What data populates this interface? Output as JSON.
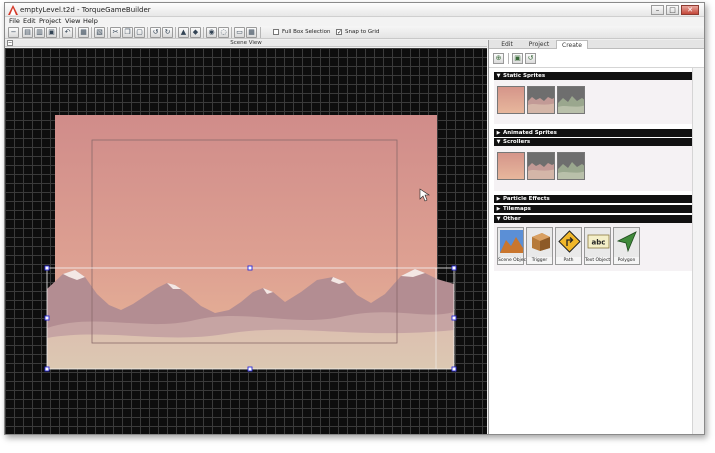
{
  "window": {
    "title": "emptyLevel.t2d - TorqueGameBuilder",
    "app_icon": "torque-logo-icon",
    "controls": [
      "minimize-icon",
      "maximize-icon",
      "close-icon"
    ]
  },
  "menubar": [
    "File",
    "Edit",
    "Project",
    "View",
    "Help"
  ],
  "toolbar": {
    "full_box_selection": {
      "label": "Full Box Selection",
      "checked": false
    },
    "snap_to_grid": {
      "label": "Snap to Grid",
      "checked": true
    }
  },
  "scene_view": {
    "title": "Scene View",
    "background_color": "#0d0d0d",
    "grid_color": "#3a3a3a",
    "sky_colors": [
      "#d49088",
      "#e4b69a"
    ],
    "ground_color": "#dcc4ae",
    "mountain_color": "#b38c90",
    "selection_handle_color": "#2a2ad8"
  },
  "panel": {
    "tabs": [
      "Edit",
      "Project",
      "Create"
    ],
    "active_tab": "Create",
    "sections": {
      "static_sprites": "Static Sprites",
      "animated_sprites": "Animated Sprites",
      "scrollers": "Scrollers",
      "particle_effects": "Particle Effects",
      "tilemaps": "Tilemaps",
      "other": "Other"
    },
    "other_items": [
      "Scene Object",
      "Trigger",
      "Path",
      "Text Object",
      "Polygon"
    ]
  }
}
